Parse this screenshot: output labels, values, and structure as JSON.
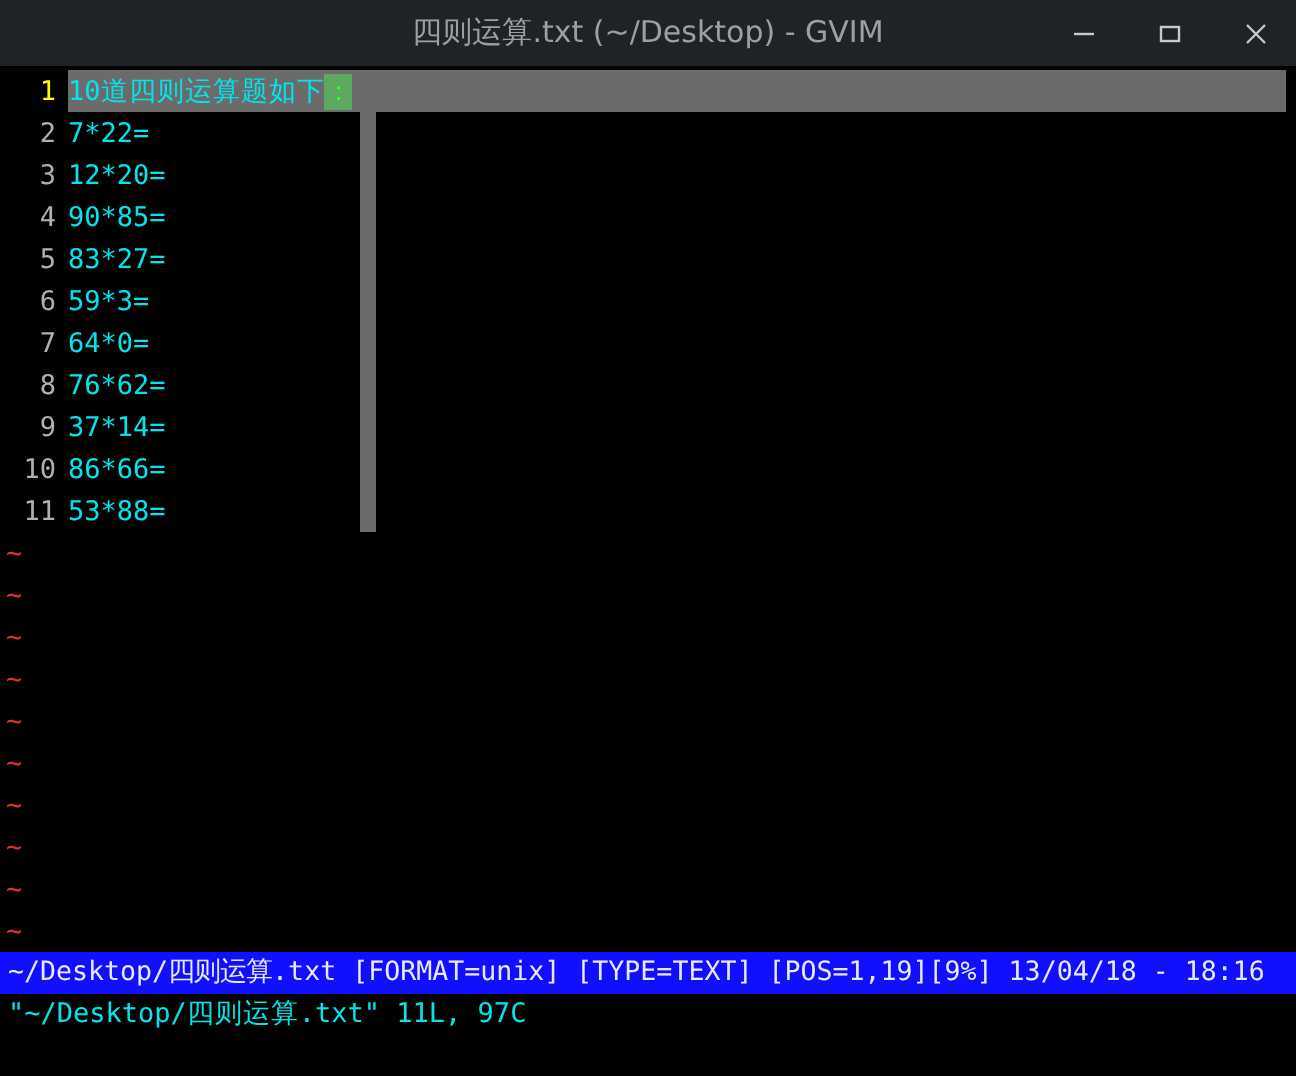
{
  "window": {
    "title": "四则运算.txt (~/Desktop) - GVIM"
  },
  "lines": [
    {
      "number": "1",
      "text": "10道四则运算题如下",
      "cursor": "：",
      "selected": true
    },
    {
      "number": "2",
      "text": "7*22=",
      "selected": false
    },
    {
      "number": "3",
      "text": "12*20=",
      "selected": false
    },
    {
      "number": "4",
      "text": "90*85=",
      "selected": false
    },
    {
      "number": "5",
      "text": "83*27=",
      "selected": false
    },
    {
      "number": "6",
      "text": "59*3=",
      "selected": false
    },
    {
      "number": "7",
      "text": "64*0=",
      "selected": false
    },
    {
      "number": "8",
      "text": "76*62=",
      "selected": false
    },
    {
      "number": "9",
      "text": "37*14=",
      "selected": false
    },
    {
      "number": "10",
      "text": "86*66=",
      "selected": false
    },
    {
      "number": "11",
      "text": "53*88=",
      "selected": false
    }
  ],
  "empty_lines": [
    "~",
    "~",
    "~",
    "~",
    "~",
    "~",
    "~",
    "~",
    "~",
    "~"
  ],
  "status_line": "~/Desktop/四则运算.txt [FORMAT=unix] [TYPE=TEXT] [POS=1,19][9%] 13/04/18 - 18:16",
  "message": "\"~/Desktop/四则运算.txt\" 11L, 97C"
}
